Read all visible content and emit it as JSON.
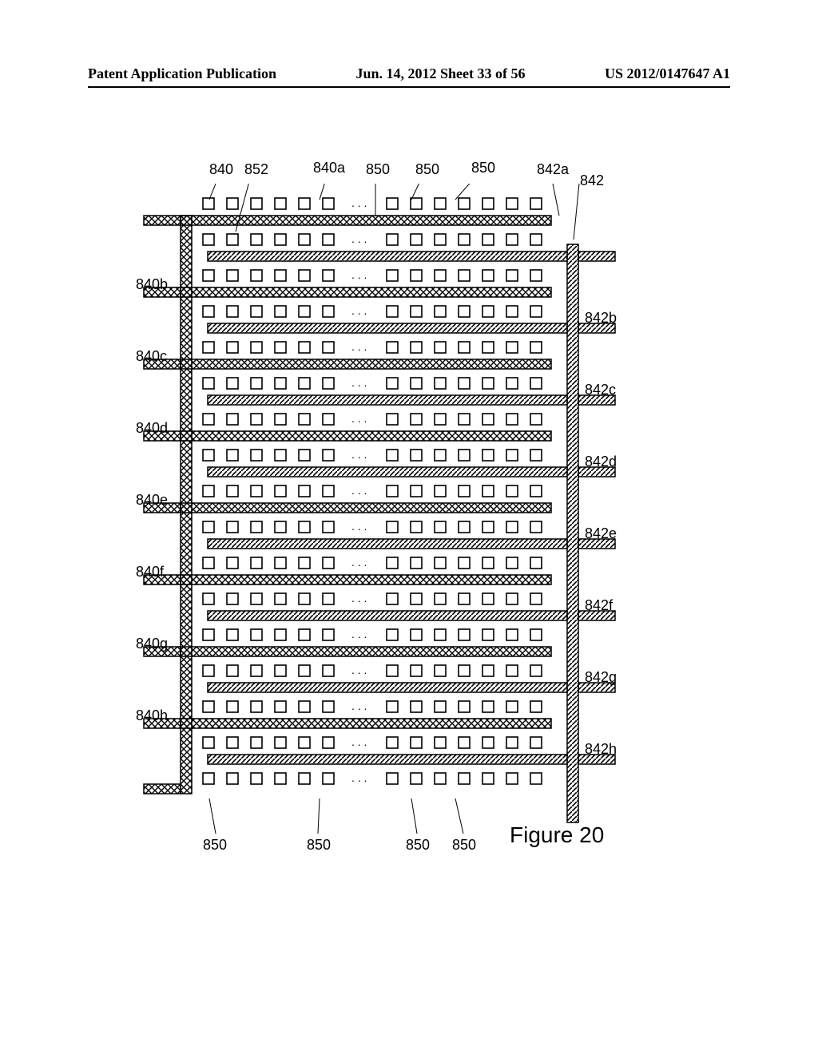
{
  "header": {
    "left": "Patent Application Publication",
    "center": "Jun. 14, 2012  Sheet 33 of 56",
    "right": "US 2012/0147647 A1"
  },
  "labels": {
    "top": {
      "t840": "840",
      "t852": "852",
      "t840a": "840a",
      "t850_1": "850",
      "t850_2": "850",
      "t850_3": "850",
      "t842a": "842a",
      "t842": "842"
    },
    "left": {
      "l840b": "840b",
      "l840c": "840c",
      "l840d": "840d",
      "l840e": "840e",
      "l840f": "840f",
      "l840g": "840g",
      "l840h": "840h"
    },
    "right": {
      "r842b": "842b",
      "r842c": "842c",
      "r842d": "842d",
      "r842e": "842e",
      "r842f": "842f",
      "r842g": "842g",
      "r842h": "842h"
    },
    "bottom": {
      "b850_1": "850",
      "b850_2": "850",
      "b850_3": "850",
      "b850_4": "850"
    }
  },
  "figure_caption": "Figure 20",
  "dots": ". . .",
  "chart_data": {
    "type": "diagram",
    "description": "Interdigitated comb electrode layout with two sets (840 left-connected, 842 right-connected) of horizontal interleaved fingers. Rows of contact squares (850) between fingers.",
    "left_fingers": [
      "840a",
      "840b",
      "840c",
      "840d",
      "840e",
      "840f",
      "840g",
      "840h"
    ],
    "right_fingers": [
      "842a",
      "842b",
      "842c",
      "842d",
      "842e",
      "842f",
      "842g",
      "842h"
    ],
    "contact_label": "850",
    "bus_left": "852",
    "bus_right": "842",
    "squares_per_row_left_group": 6,
    "squares_per_row_right_group": 7,
    "rows_of_squares": 17
  }
}
